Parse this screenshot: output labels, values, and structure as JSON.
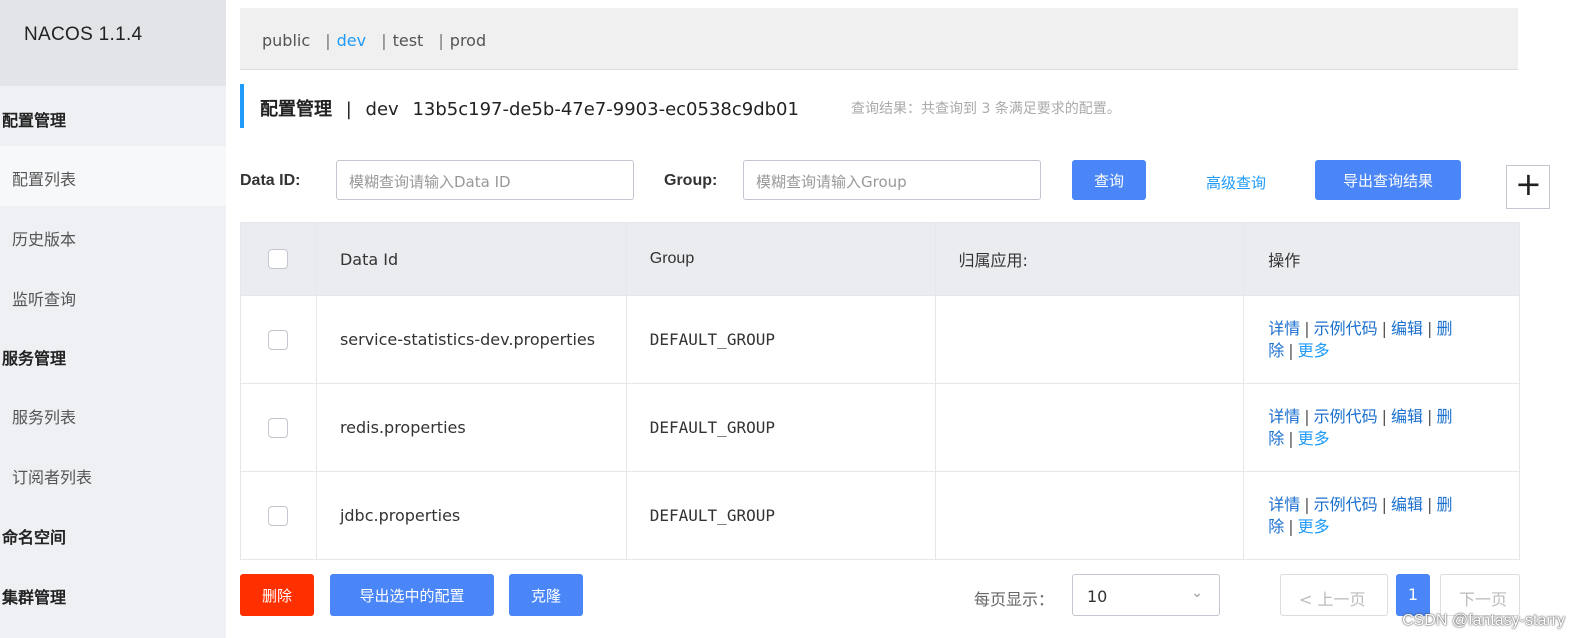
{
  "brand": "NACOS 1.1.4",
  "sidebar": {
    "groups": [
      {
        "label": "配置管理"
      },
      {
        "label": "服务管理"
      },
      {
        "label": "命名空间"
      },
      {
        "label": "集群管理"
      }
    ],
    "items": [
      {
        "label": "配置列表"
      },
      {
        "label": "历史版本"
      },
      {
        "label": "监听查询"
      },
      {
        "label": "服务列表"
      },
      {
        "label": "订阅者列表"
      }
    ]
  },
  "namespaces": [
    "public",
    "dev",
    "test",
    "prod"
  ],
  "active_namespace": "dev",
  "title": {
    "main": "配置管理",
    "sep": "|",
    "namespace": "dev",
    "namespace_id": "13b5c197-de5b-47e7-9903-ec0538c9db01",
    "hint": "查询结果：共查询到 3 条满足要求的配置。"
  },
  "search": {
    "data_id_label": "Data ID:",
    "data_id_placeholder": "模糊查询请输入Data ID",
    "group_label": "Group:",
    "group_placeholder": "模糊查询请输入Group",
    "query_button": "查询",
    "advanced_link": "高级查询",
    "export_button": "导出查询结果",
    "plus": "+"
  },
  "table": {
    "headers": [
      "Data Id",
      "Group",
      "归属应用:",
      "操作"
    ],
    "rows": [
      {
        "data_id": "service-statistics-dev.properties",
        "group": "DEFAULT_GROUP",
        "app": ""
      },
      {
        "data_id": "redis.properties",
        "group": "DEFAULT_GROUP",
        "app": ""
      },
      {
        "data_id": "jdbc.properties",
        "group": "DEFAULT_GROUP",
        "app": ""
      }
    ],
    "ops": {
      "detail": "详情",
      "sample": "示例代码",
      "edit": "编辑",
      "delete_part1": "删",
      "delete_part2": "除",
      "more": "更多",
      "sep": "|"
    }
  },
  "footer": {
    "delete_button": "删除",
    "export_selected_button": "导出选中的配置",
    "clone_button": "克隆",
    "page_size_label": "每页显示：",
    "page_size_value": "10",
    "prev_button": "< 上一页",
    "current_page": "1",
    "next_button": "下一页"
  },
  "watermark": "CSDN @fantasy-starry",
  "colors": {
    "accent": "#209bfa",
    "primary_button": "#4a86f7",
    "danger_button": "#ff3000"
  }
}
